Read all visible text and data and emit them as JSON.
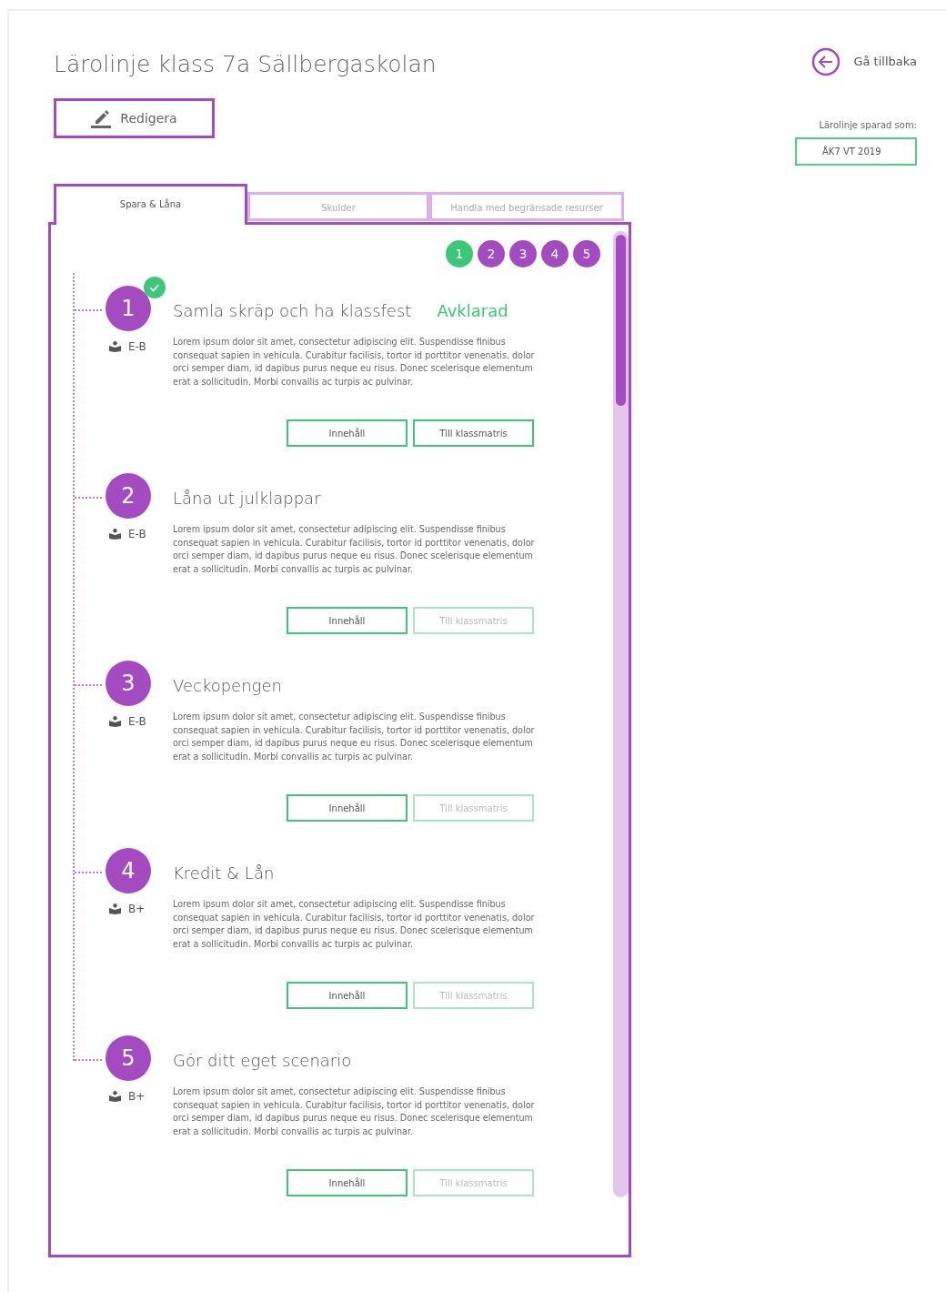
{
  "title": "Lärolinje klass 7a Sällbergaskolan",
  "edit_button": "Redigera",
  "back_link": "Gå tillbaka",
  "saved_label": "Lärolinje sparad som:",
  "saved_name": "ÅK7 VT 2019",
  "tabs": [
    {
      "label": "Spara & Låna",
      "selected": true
    },
    {
      "label": "Skulder",
      "selected": false
    },
    {
      "label": "Handla med begränsade resurser",
      "selected": false
    }
  ],
  "pager": [
    {
      "label": "1",
      "completed": true
    },
    {
      "label": "2",
      "completed": false
    },
    {
      "label": "3",
      "completed": false
    },
    {
      "label": "4",
      "completed": false
    },
    {
      "label": "5",
      "completed": false
    }
  ],
  "steps": [
    {
      "number": "1",
      "completed": true,
      "title": "Samla skräp och ha klassfest",
      "status": "Avklarad",
      "level": "E-B",
      "text": "Lorem ipsum dolor sit amet, consectetur adipiscing elit. Suspendisse finibus consequat sapien in vehicula. Curabitur facilisis, tortor id porttitor venenatis, dolor orci semper diam, id dapibus purus neque eu risus. Donec scelerisque elementum erat a sollicitudin. Morbi convallis ac turpis ac pulvinar.",
      "buttons": [
        {
          "label": "Innehåll",
          "disabled": false
        },
        {
          "label": "Till klassmatris",
          "disabled": false
        }
      ]
    },
    {
      "number": "2",
      "completed": false,
      "title": "Låna ut julklappar",
      "level": "E-B",
      "text": "Lorem ipsum dolor sit amet, consectetur adipiscing elit. Suspendisse finibus consequat sapien in vehicula. Curabitur facilisis, tortor id porttitor venenatis, dolor orci semper diam, id dapibus purus neque eu risus. Donec scelerisque elementum erat a sollicitudin. Morbi convallis ac turpis ac pulvinar.",
      "buttons": [
        {
          "label": "Innehåll",
          "disabled": false
        },
        {
          "label": "Till klassmatris",
          "disabled": true
        }
      ]
    },
    {
      "number": "3",
      "completed": false,
      "title": "Veckopengen",
      "level": "E-B",
      "text": "Lorem ipsum dolor sit amet, consectetur adipiscing elit. Suspendisse finibus consequat sapien in vehicula. Curabitur facilisis, tortor id porttitor venenatis, dolor orci semper diam, id dapibus purus neque eu risus. Donec scelerisque elementum erat a sollicitudin. Morbi convallis ac turpis ac pulvinar.",
      "buttons": [
        {
          "label": "Innehåll",
          "disabled": false
        },
        {
          "label": "Till klassmatris",
          "disabled": true
        }
      ]
    },
    {
      "number": "4",
      "completed": false,
      "title": "Kredit & Lån",
      "level": "B+",
      "text": "Lorem ipsum dolor sit amet, consectetur adipiscing elit. Suspendisse finibus consequat sapien in vehicula. Curabitur facilisis, tortor id porttitor venenatis, dolor orci semper diam, id dapibus purus neque eu risus. Donec scelerisque elementum erat a sollicitudin. Morbi convallis ac turpis ac pulvinar.",
      "buttons": [
        {
          "label": "Innehåll",
          "disabled": false
        },
        {
          "label": "Till klassmatris",
          "disabled": true
        }
      ]
    },
    {
      "number": "5",
      "completed": false,
      "title": "Gör ditt eget scenario",
      "level": "B+",
      "text": "Lorem ipsum dolor sit amet, consectetur adipiscing elit. Suspendisse finibus consequat sapien in vehicula. Curabitur facilisis, tortor id porttitor venenatis, dolor orci semper diam, id dapibus purus neque eu risus. Donec scelerisque elementum erat a sollicitudin. Morbi convallis ac turpis ac pulvinar.",
      "buttons": [
        {
          "label": "Innehåll",
          "disabled": false
        },
        {
          "label": "Till klassmatris",
          "disabled": true
        }
      ]
    }
  ]
}
